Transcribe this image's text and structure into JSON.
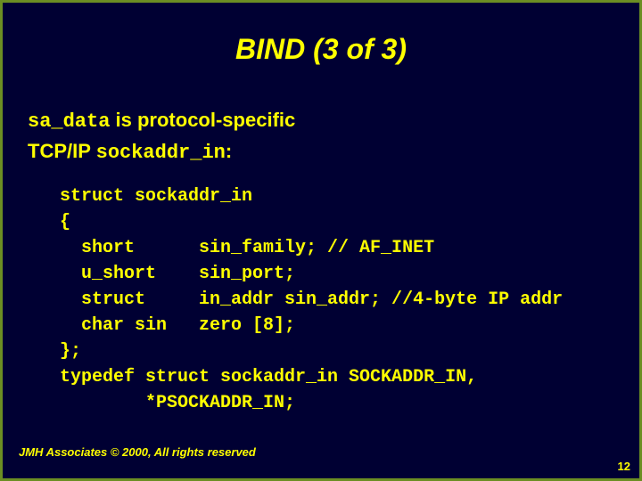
{
  "title": "BIND (3 of 3)",
  "line1_a": "sa_data",
  "line1_b": " is protocol-specific",
  "line2_a": "TCP/IP ",
  "line2_b": "sockaddr_in",
  "line2_c": ":",
  "code": "struct sockaddr_in\n{\n  short      sin_family; // AF_INET\n  u_short    sin_port;\n  struct     in_addr sin_addr; //4-byte IP addr\n  char sin   zero [8];\n};\ntypedef struct sockaddr_in SOCKADDR_IN,\n        *PSOCKADDR_IN;",
  "footer": "JMH Associates © 2000, All rights reserved",
  "page": "12"
}
